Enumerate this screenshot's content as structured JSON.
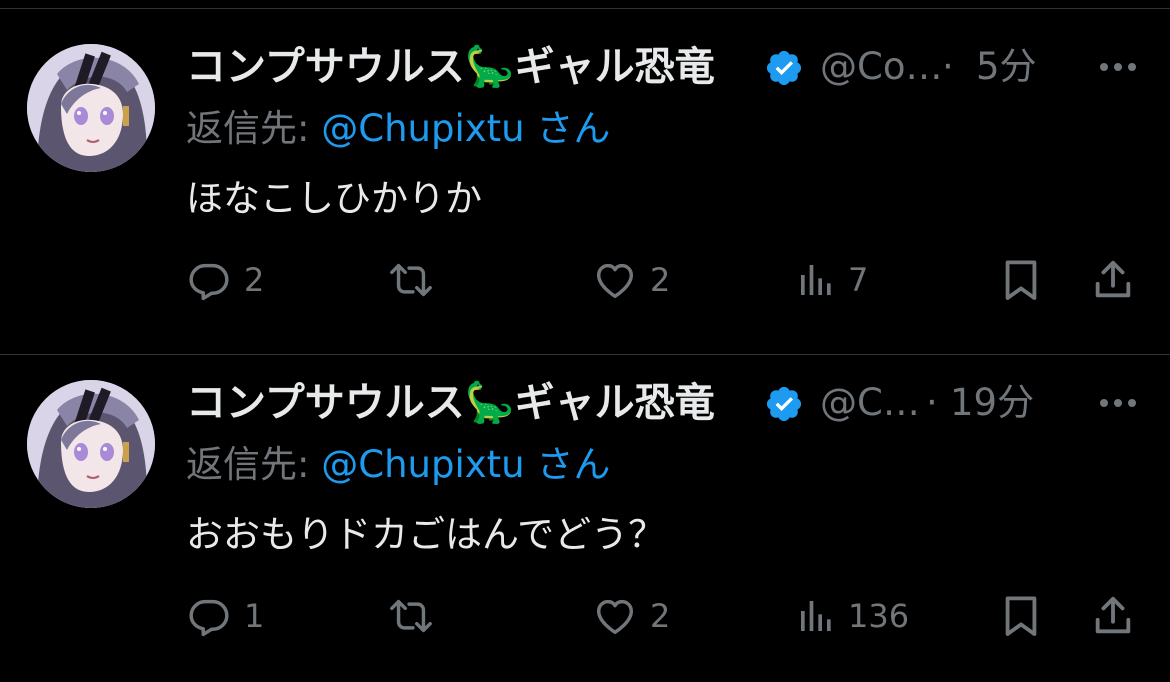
{
  "colors": {
    "background": "#000000",
    "primary_text": "#e7e9ea",
    "secondary_text": "#71767b",
    "link": "#1d9bf0",
    "verified": "#1d9bf0",
    "divider": "#2f3336"
  },
  "tweets": [
    {
      "display_name": "コンプサウルス🦕ギャル恐竜",
      "handle": "@Co…",
      "separator": "·",
      "time": "5分",
      "reply_label": "返信先:",
      "reply_user": "@Chupixtu",
      "reply_suffix": "さん",
      "text": "ほなこしひかりか",
      "replies": "2",
      "retweets": "",
      "likes": "2",
      "views": "7",
      "icons": [
        "verified-icon",
        "more-icon",
        "reply-icon",
        "retweet-icon",
        "like-icon",
        "views-icon",
        "bookmark-icon",
        "share-icon"
      ]
    },
    {
      "display_name": "コンプサウルス🦕ギャル恐竜",
      "handle": "@C…",
      "separator": "·",
      "time": "19分",
      "reply_label": "返信先:",
      "reply_user": "@Chupixtu",
      "reply_suffix": "さん",
      "text": "おおもりドカごはんでどう？",
      "replies": "1",
      "retweets": "",
      "likes": "2",
      "views": "136",
      "icons": [
        "verified-icon",
        "more-icon",
        "reply-icon",
        "retweet-icon",
        "like-icon",
        "views-icon",
        "bookmark-icon",
        "share-icon"
      ]
    }
  ]
}
